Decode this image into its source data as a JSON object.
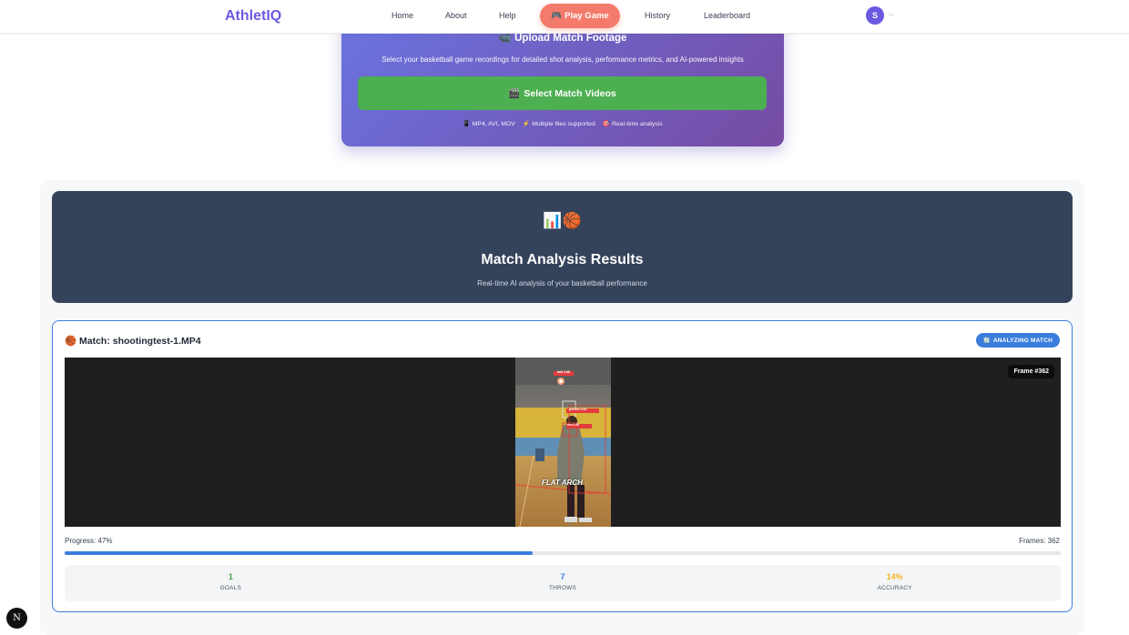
{
  "nav": {
    "logo": "AthletIQ",
    "links": [
      "Home",
      "About",
      "Help",
      "History",
      "Leaderboard"
    ],
    "play_label": "Play Game",
    "play_icon": "🎮",
    "avatar_initial": "S"
  },
  "upload": {
    "title": "Upload Match Footage",
    "title_icon": "📹",
    "subtitle": "Select your basketball game recordings for detailed shot analysis, performance metrics, and AI-powered insights",
    "button_label": "Select Match Videos",
    "button_icon": "🎬",
    "meta": [
      {
        "icon": "📱",
        "text": "MP4, AVI, MOV"
      },
      {
        "icon": "⚡",
        "text": "Multiple files supported"
      },
      {
        "icon": "🎯",
        "text": "Real-time analysis"
      }
    ]
  },
  "results": {
    "hero_icons": "📊🏀",
    "title": "Match Analysis Results",
    "subtitle": "Real-time AI analysis of your basketball performance"
  },
  "match": {
    "icon": "🏀",
    "title": "Match: shootingtest-1.MP4",
    "badge": "ANALYZING MATCH",
    "badge_icon": "🔄",
    "frame_tag": "Frame #362",
    "overlay_ball": "ball 0.88",
    "overlay_person": "person 0.92",
    "overlay_rim": "rim 0.85",
    "overlay_text": "FLAT ARCH",
    "progress_label": "Progress: 47%",
    "progress": 0.47,
    "frames_label": "Frames: 362",
    "stats": [
      {
        "value": "1",
        "label": "GOALS",
        "color": "#43a047"
      },
      {
        "value": "7",
        "label": "THROWS",
        "color": "#3b7ddd"
      },
      {
        "value": "14%",
        "label": "ACCURACY",
        "color": "#f5b324"
      }
    ]
  },
  "next_badge": "N"
}
